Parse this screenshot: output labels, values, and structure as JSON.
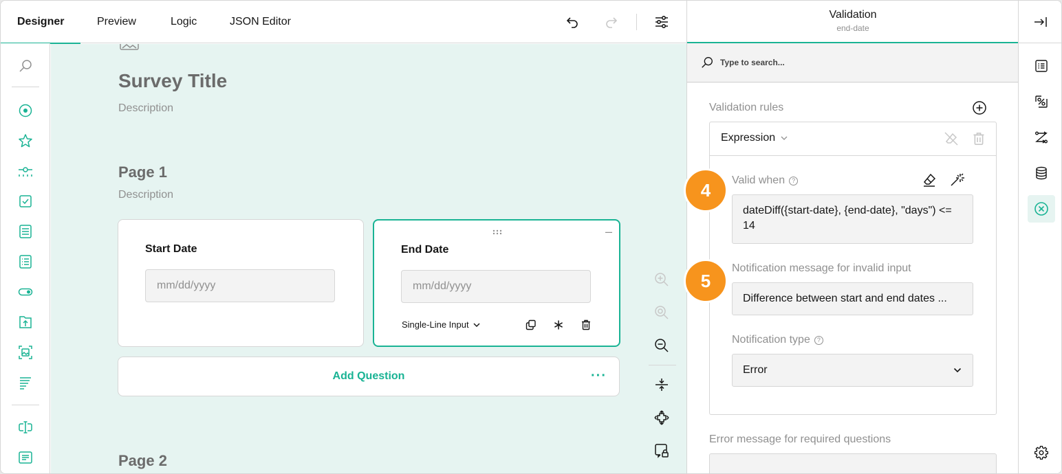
{
  "tabs": [
    {
      "label": "Designer",
      "active": true
    },
    {
      "label": "Preview",
      "active": false
    },
    {
      "label": "Logic",
      "active": false
    },
    {
      "label": "JSON Editor",
      "active": false
    }
  ],
  "toolbar_icons": [
    "undo-icon",
    "redo-icon",
    "settings-sliders-icon"
  ],
  "toolbox_icons": [
    "search-icon",
    "radio-group-icon",
    "rating-icon",
    "slider-icon",
    "checkbox-icon",
    "dropdown-icon",
    "multi-select-dropdown-icon",
    "boolean-toggle-icon",
    "file-upload-icon",
    "image-picker-icon",
    "ranking-icon",
    "single-line-input-icon",
    "long-text-icon"
  ],
  "survey": {
    "title": "Survey Title",
    "description": "Description"
  },
  "pages": [
    {
      "title": "Page 1",
      "description": "Description",
      "questions": [
        {
          "title": "Start Date",
          "placeholder": "mm/dd/yyyy",
          "selected": false
        },
        {
          "title": "End Date",
          "placeholder": "mm/dd/yyyy",
          "selected": true,
          "type_label": "Single-Line Input"
        }
      ],
      "add_question_label": "Add Question"
    },
    {
      "title": "Page 2"
    }
  ],
  "zoom_icons": [
    "zoom-in-icon",
    "zoom-reset-icon",
    "zoom-out-icon",
    "collapse-all-icon",
    "expand-all-icon",
    "lock-question-icon"
  ],
  "panel": {
    "title": "Validation",
    "subtitle": "end-date",
    "search_placeholder": "Type to search...",
    "validation_rules_label": "Validation rules",
    "rule_type": "Expression",
    "valid_when_label": "Valid when",
    "valid_when_value": "dateDiff({start-date}, {end-date}, \"days\") <= 14",
    "message_label": "Notification message for invalid input",
    "message_value": "Difference between start and end dates ...",
    "notification_type_label": "Notification type",
    "notification_type_value": "Error",
    "required_error_label": "Error message for required questions"
  },
  "badges": [
    "4",
    "5"
  ],
  "right_sidebar_icons": [
    "collapse-panel-icon",
    "general-icon",
    "logic-icon",
    "navigation-icon",
    "data-icon",
    "validation-icon",
    "settings-gear-icon"
  ],
  "colors": {
    "accent": "#19b394",
    "badge": "#f7941d",
    "canvas": "#e6f4f1"
  }
}
